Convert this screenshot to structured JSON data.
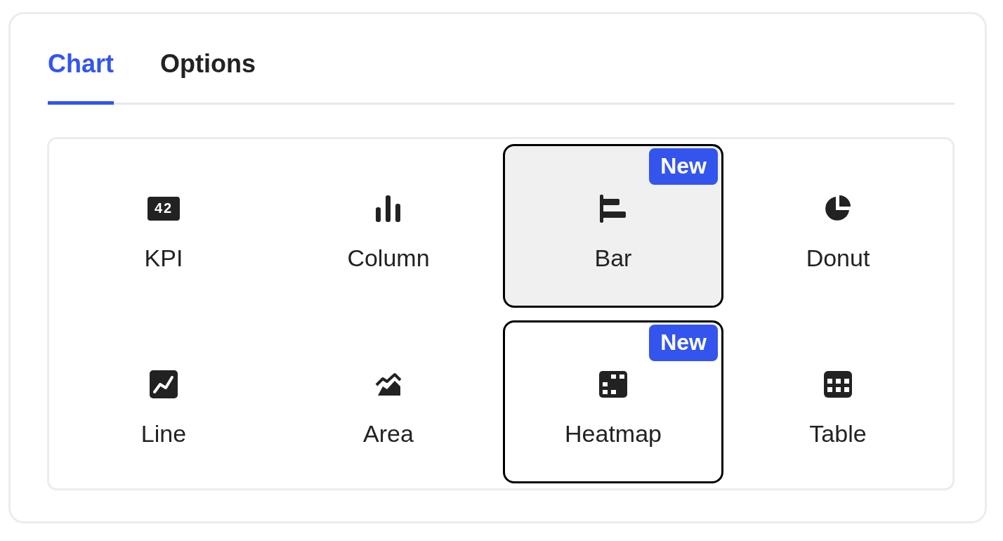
{
  "tabs": [
    {
      "label": "Chart",
      "selected": true
    },
    {
      "label": "Options",
      "selected": false
    }
  ],
  "chart_types": [
    {
      "label": "KPI",
      "kind": "kpi",
      "icon_text": "42",
      "selected": false,
      "outlined": false
    },
    {
      "label": "Column",
      "kind": "column",
      "selected": false,
      "outlined": false
    },
    {
      "label": "Bar",
      "kind": "bar",
      "selected": true,
      "outlined": true,
      "badge": "New"
    },
    {
      "label": "Donut",
      "kind": "donut",
      "selected": false,
      "outlined": false
    },
    {
      "label": "Line",
      "kind": "line",
      "selected": false,
      "outlined": false
    },
    {
      "label": "Area",
      "kind": "area",
      "selected": false,
      "outlined": false
    },
    {
      "label": "Heatmap",
      "kind": "heatmap",
      "selected": false,
      "outlined": true,
      "badge": "New"
    },
    {
      "label": "Table",
      "kind": "table",
      "selected": false,
      "outlined": false
    }
  ]
}
